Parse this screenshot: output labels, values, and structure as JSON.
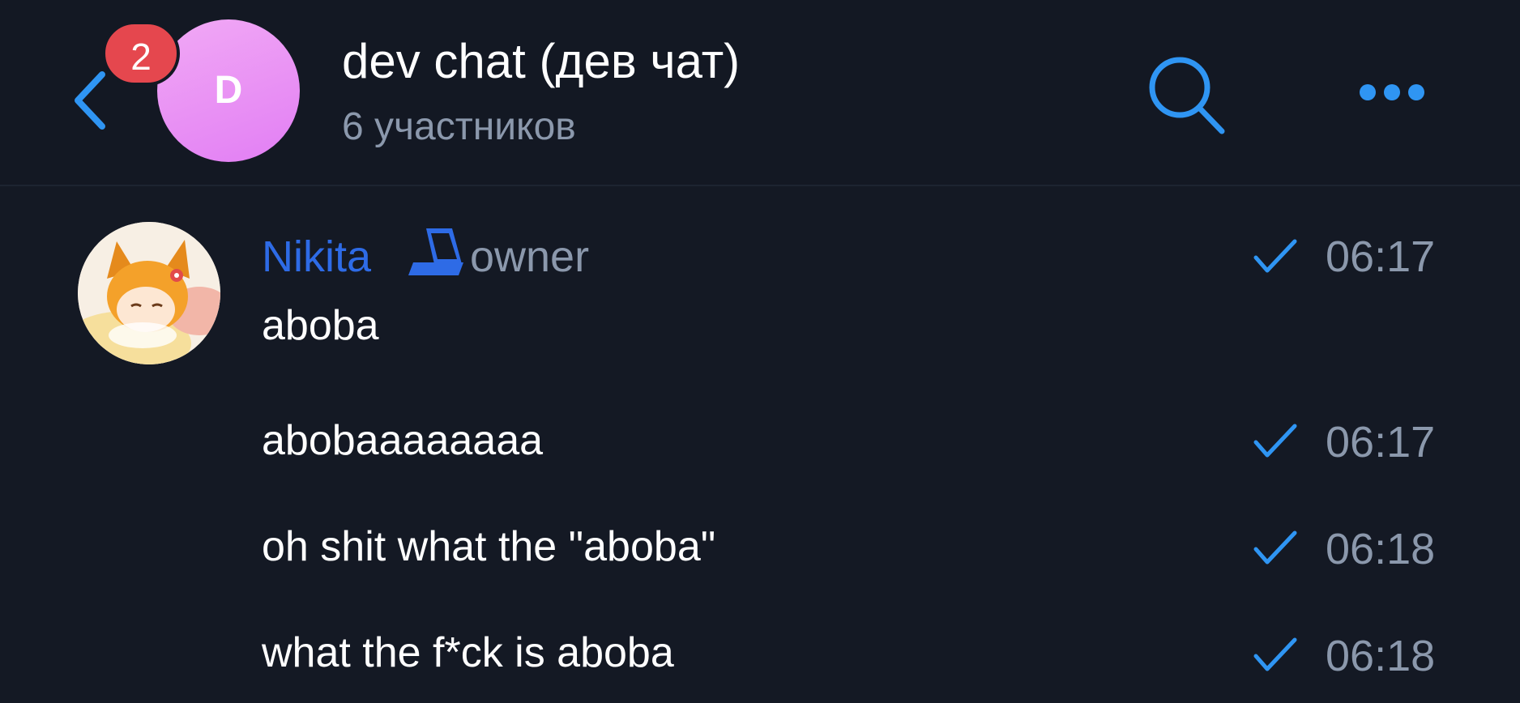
{
  "header": {
    "unread_count": "2",
    "avatar_letter": "D",
    "title": "dev chat (дев чат)",
    "subtitle": "6 участников",
    "accent_color": "#2f95f3",
    "badge_color": "#e5474e"
  },
  "sender": {
    "name": "Nikita",
    "role": "owner",
    "name_color": "#2e6be6"
  },
  "messages": [
    {
      "text": "aboba",
      "time": "06:17",
      "status": "sent-check-icon"
    },
    {
      "text": "abobaaaaaaaa",
      "time": "06:17",
      "status": "sent-check-icon"
    },
    {
      "text": "oh shit what the \"aboba\"",
      "time": "06:18",
      "status": "sent-check-icon"
    },
    {
      "text": "what the f*ck is aboba",
      "time": "06:18",
      "status": "sent-check-icon"
    }
  ]
}
